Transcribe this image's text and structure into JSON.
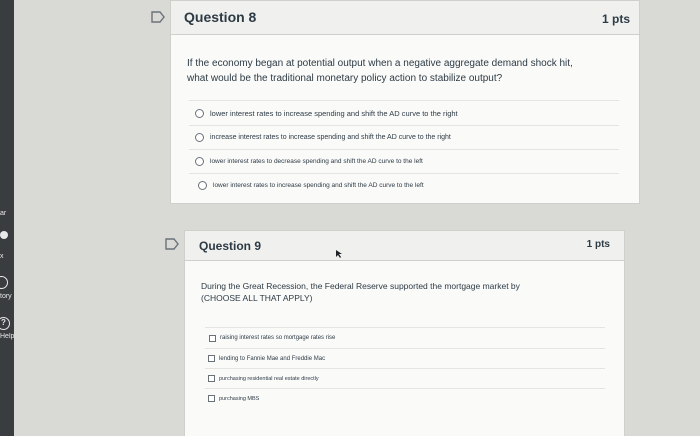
{
  "sidebar": {
    "items": [
      {
        "label": "ar",
        "icon": null
      },
      {
        "label": "",
        "icon": "dot-icon"
      },
      {
        "label": "x",
        "icon": null
      },
      {
        "label": "tory",
        "icon": "history-icon"
      },
      {
        "label": "Help",
        "icon": "help-icon",
        "glyph": "?"
      }
    ]
  },
  "questions": [
    {
      "title": "Question 8",
      "points": "1 pts",
      "text_line1": "If the economy began at potential output when a negative aggregate demand shock hit,",
      "text_line2": "what would be the traditional monetary policy action to stabilize output?",
      "type": "radio",
      "answers": [
        "lower interest rates to increase spending and shift the AD curve to the right",
        "increase interest rates to increase spending and shift the AD curve to the right",
        "lower interest rates to decrease spending and shift the AD curve to the left",
        "lower interest rates to increase spending and shift the AD curve to the left"
      ]
    },
    {
      "title": "Question 9",
      "points": "1 pts",
      "text_line1": "During the Great Recession, the Federal Reserve supported the mortgage market by",
      "text_line2": "(CHOOSE ALL THAT APPLY)",
      "type": "checkbox",
      "answers": [
        "raising interest rates so mortgage rates rise",
        "lending to Fannie Mae and Freddie Mac",
        "purchasing residential real estate directly",
        "purchasing MBS"
      ]
    }
  ],
  "colors": {
    "background": "#d9d9d6",
    "card": "#fafaf9",
    "header": "#f0f0ee",
    "text": "#2d3b45",
    "sidebar": "#3a3d40"
  }
}
